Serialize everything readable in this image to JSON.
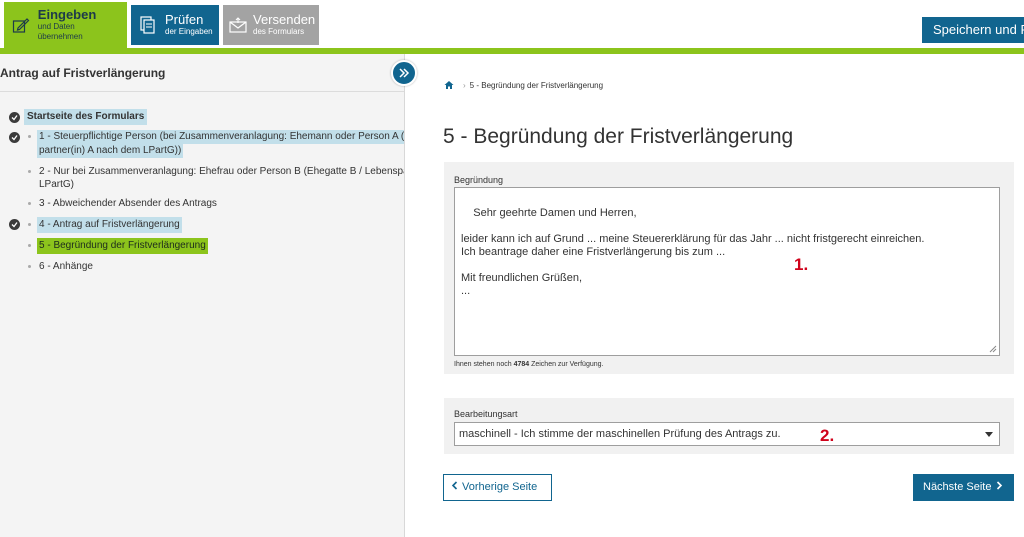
{
  "topbar": {
    "steps": [
      {
        "title": "Eingeben",
        "subtitle": "und Daten übernehmen",
        "icon": "edit-icon"
      },
      {
        "title": "Prüfen",
        "subtitle": "der Eingaben",
        "icon": "document-check-icon"
      },
      {
        "title": "Versenden",
        "subtitle": "des Formulars",
        "icon": "envelope-icon"
      }
    ],
    "save_label": "Speichern und Formular schließen",
    "colors": {
      "green": "#8cc41c",
      "blue": "#11658f",
      "gray": "#a3a3a3"
    }
  },
  "sidebar": {
    "title": "Antrag auf Fristverlängerung",
    "items": [
      {
        "label": "Startseite des Formulars",
        "checked": true
      },
      {
        "label_line1": "1 - Steuerpflichtige Person (bei Zusammenveranlagung: Ehemann oder Person A (Ehegatte A / Lebens-",
        "label_line2": "partner(in) A nach dem LPartG))",
        "checked": true
      },
      {
        "label_line1": "2 - Nur bei Zusammenveranlagung: Ehefrau oder Person B (Ehegatte B / Lebenspartner(in) B nach dem",
        "label_line2": "LPartG)",
        "checked": false
      },
      {
        "label": "3 - Abweichender Absender des Antrags",
        "checked": false
      },
      {
        "label": "4 - Antrag auf Fristverlängerung",
        "checked": true
      },
      {
        "label": "5 - Begründung der Fristverlängerung",
        "checked": false,
        "active": true
      },
      {
        "label": "6 - Anhänge",
        "checked": false
      }
    ]
  },
  "main": {
    "breadcrumb": "5 - Begründung der Fristverlängerung",
    "title": "5 - Begründung der Fristverlängerung",
    "begruendung_label": "Begründung",
    "begruendung_value": "Sehr geehrte Damen und Herren,\n\nleider kann ich auf Grund ... meine Steuererklärung für das Jahr ... nicht fristgerecht einreichen.\nIch beantrage daher eine Fristverlängerung bis zum ...\n\nMit freundlichen Grüßen,\n...",
    "counter_prefix": "Ihnen stehen noch ",
    "counter_value": "4784",
    "counter_suffix": " Zeichen zur Verfügung.",
    "bearbeitungsart_label": "Bearbeitungsart",
    "bearbeitungsart_value": "maschinell - Ich stimme der maschinellen Prüfung des Antrags zu.",
    "annotation_1": "1.",
    "annotation_2": "2.",
    "prev_label": "Vorherige Seite",
    "next_label": "Nächste Seite"
  }
}
